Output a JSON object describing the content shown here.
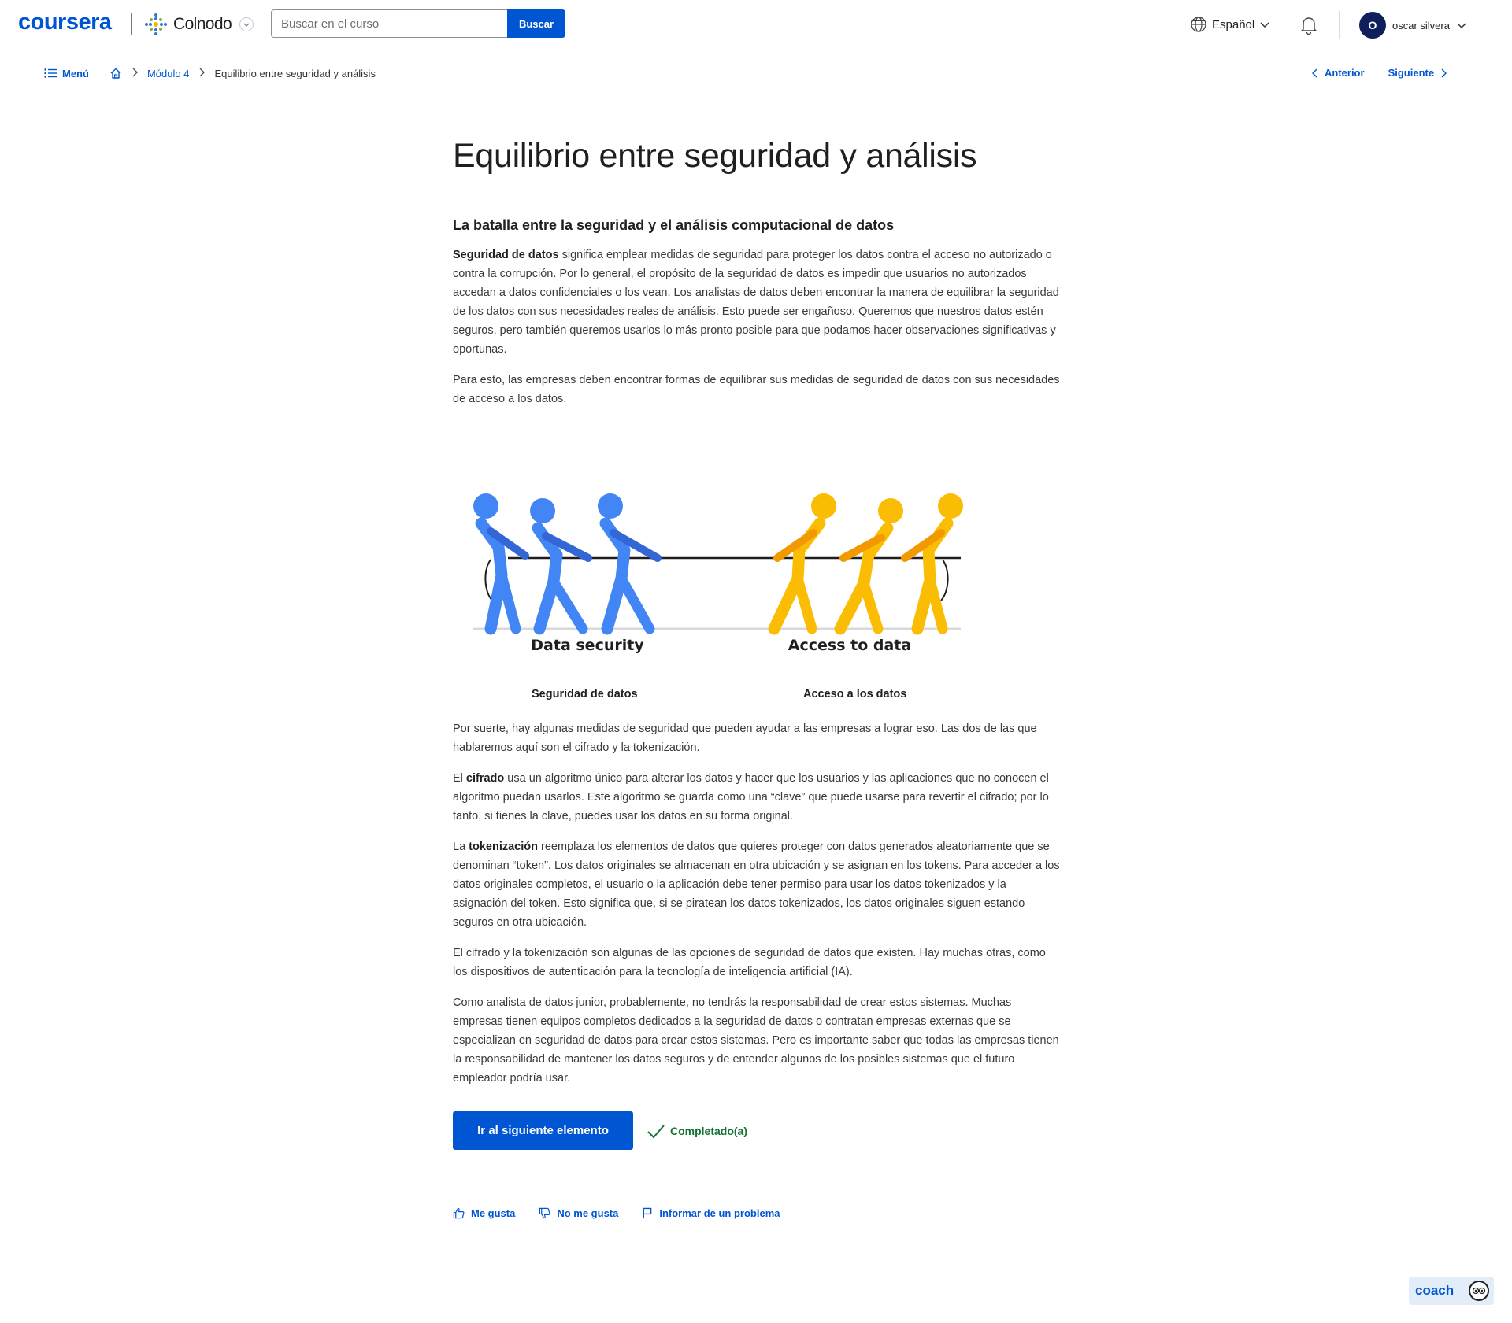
{
  "header": {
    "logo": "coursera",
    "partner_name": "Colnodo",
    "search_placeholder": "Buscar en el curso",
    "search_button": "Buscar",
    "language": "Español",
    "user_initial": "O",
    "user_name": "oscar silvera"
  },
  "breadcrumb": {
    "menu_label": "Menú",
    "module_label": "Módulo 4",
    "current_label": "Equilibrio entre seguridad y análisis"
  },
  "pager": {
    "prev_label": "Anterior",
    "next_label": "Siguiente"
  },
  "article": {
    "title": "Equilibrio entre seguridad y análisis",
    "subheading": "La batalla entre la seguridad y el análisis computacional de datos",
    "p1_bold": "Seguridad de datos",
    "p1_rest": " significa emplear medidas de seguridad para proteger los datos contra el acceso no autorizado o contra la corrupción. Por lo general, el propósito de la seguridad de datos es impedir que usuarios no autorizados accedan a datos confidenciales o los vean. Los analistas de datos deben encontrar la manera de equilibrar la seguridad de los datos con sus necesidades reales de análisis. Esto puede ser engañoso. Queremos que nuestros datos estén seguros, pero también queremos usarlos lo más pronto posible para que podamos hacer observaciones significativas y oportunas.",
    "p2": "Para esto, las empresas deben encontrar formas de equilibrar sus medidas de seguridad de datos con sus necesidades de acceso a los datos.",
    "figure_left_label": "Data security",
    "figure_right_label": "Access to data",
    "caption_left": "Seguridad de datos",
    "caption_right": "Acceso a los datos",
    "p3": "Por suerte, hay algunas medidas de seguridad que pueden ayudar a las empresas a lograr eso. Las dos de las que hablaremos aquí son el cifrado y la tokenización.",
    "p4_pre": "El ",
    "p4_bold": "cifrado",
    "p4_rest": " usa un algoritmo único para alterar los datos y hacer que los usuarios y las aplicaciones que no conocen el algoritmo puedan usarlos. Este algoritmo se guarda como una “clave” que puede usarse para revertir el cifrado; por lo tanto, si tienes la clave, puedes usar los datos en su forma original.",
    "p5_pre": "La ",
    "p5_bold": "tokenización",
    "p5_rest": " reemplaza los elementos de datos que quieres proteger con datos generados aleatoriamente que se denominan “token”. Los datos originales se almacenan en otra ubicación y se asignan en los tokens. Para acceder a los datos originales completos, el usuario o la aplicación debe tener permiso para usar los datos tokenizados y la asignación del token. Esto significa que, si se piratean los datos tokenizados, los datos originales siguen estando seguros en otra ubicación.",
    "p6": "El cifrado y la tokenización son algunas de las opciones de seguridad de datos que existen. Hay muchas otras, como los dispositivos de autenticación para la tecnología de inteligencia artificial (IA).",
    "p7": "Como analista de datos junior, probablemente, no tendrás la responsabilidad de crear estos sistemas. Muchas empresas tienen equipos completos dedicados a la seguridad de datos o contratan empresas externas que se especializan en seguridad de datos para crear estos sistemas. Pero es importante saber que todas las empresas tienen la responsabilidad de mantener los datos seguros y de entender algunos de los posibles sistemas que el futuro empleador podría usar."
  },
  "actions": {
    "next_button": "Ir al siguiente elemento",
    "completed_label": "Completado(a)"
  },
  "feedback": {
    "like": "Me gusta",
    "dislike": "No me gusta",
    "report": "Informar de un problema"
  },
  "coach": {
    "label": "coach"
  },
  "colors": {
    "accent": "#0056d2",
    "blue_team": "#4285f4",
    "yellow_team": "#fbbc04",
    "success": "#137333"
  }
}
